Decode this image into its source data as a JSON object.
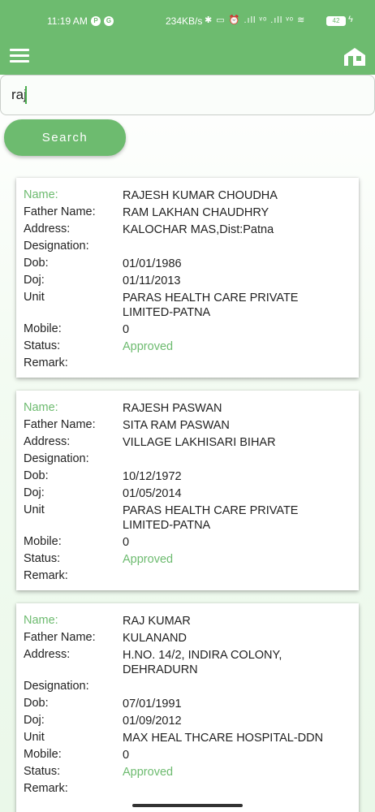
{
  "status_bar": {
    "time": "11:19 AM",
    "speed": "234KB/s",
    "icons": "✱ ▭ ⏰ .ıll ᵛᵒ .ıll ᵛᵒ ≋",
    "battery": "42"
  },
  "header": {
    "menu_icon": "hamburger-menu-icon",
    "home_icon": "home-icon",
    "color": "#6dbb6f"
  },
  "search": {
    "value": "raj",
    "button_label": "Search"
  },
  "labels": {
    "name": "Name:",
    "father": "Father Name:",
    "address": "Address:",
    "designation": "Designation:",
    "dob": "Dob:",
    "doj": "Doj:",
    "unit": "Unit",
    "mobile": "Mobile:",
    "status": "Status:",
    "remark": "Remark:"
  },
  "results": [
    {
      "name": "RAJESH KUMAR CHOUDHA",
      "father": "RAM LAKHAN CHAUDHRY",
      "address": "KALOCHAR MAS,Dist:Patna",
      "designation": "",
      "dob": "01/01/1986",
      "doj": "01/11/2013",
      "unit": "PARAS HEALTH CARE PRIVATE LIMITED-PATNA",
      "mobile": "0",
      "status": "Approved",
      "remark": ""
    },
    {
      "name": "RAJESH PASWAN",
      "father": "SITA RAM PASWAN",
      "address": "VILLAGE LAKHISARI BIHAR",
      "designation": "",
      "dob": "10/12/1972",
      "doj": "01/05/2014",
      "unit": "PARAS HEALTH CARE PRIVATE LIMITED-PATNA",
      "mobile": "0",
      "status": "Approved",
      "remark": ""
    },
    {
      "name": "RAJ KUMAR",
      "father": "KULANAND",
      "address": "H.NO. 14/2, INDIRA COLONY, DEHRADURN",
      "designation": "",
      "dob": "07/01/1991",
      "doj": "01/09/2012",
      "unit": "MAX HEAL THCARE HOSPITAL-DDN",
      "mobile": "0",
      "status": "Approved",
      "remark": ""
    }
  ]
}
